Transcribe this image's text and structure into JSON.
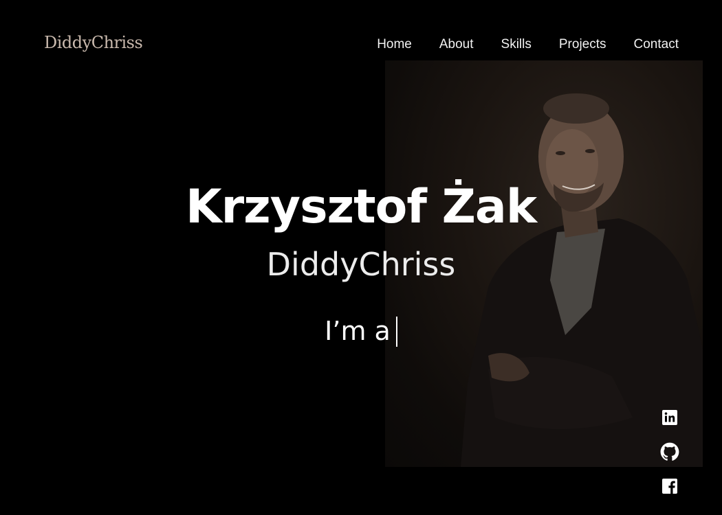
{
  "header": {
    "logo": "DiddyChriss",
    "nav": [
      {
        "label": "Home"
      },
      {
        "label": "About"
      },
      {
        "label": "Skills"
      },
      {
        "label": "Projects"
      },
      {
        "label": "Contact"
      }
    ]
  },
  "hero": {
    "name": "Krzysztof Żak",
    "nickname": "DiddyChriss",
    "typed_prefix": "I’m a"
  },
  "socials": [
    {
      "icon": "linkedin-icon"
    },
    {
      "icon": "github-icon"
    },
    {
      "icon": "facebook-icon"
    }
  ],
  "colors": {
    "background": "#000000",
    "text": "#ffffff",
    "logo": "#c9b9ad"
  }
}
